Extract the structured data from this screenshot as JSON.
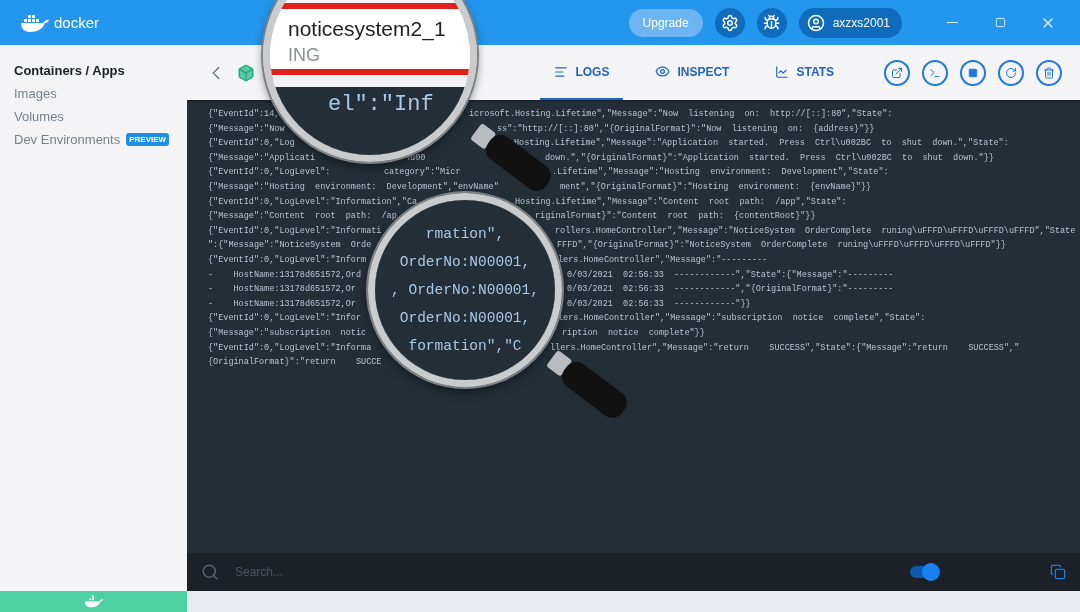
{
  "topbar": {
    "logo_text": "docker",
    "upgrade": "Upgrade",
    "user": "axzxs2001"
  },
  "sidebar": {
    "items": [
      {
        "label": "Containers / Apps",
        "selected": true
      },
      {
        "label": "Images",
        "selected": false
      },
      {
        "label": "Volumes",
        "selected": false
      },
      {
        "label": "Dev Environments",
        "selected": false,
        "badge": "PREVIEW"
      }
    ]
  },
  "tabs": [
    {
      "label": "LOGS",
      "selected": true
    },
    {
      "label": "INSPECT",
      "selected": false
    },
    {
      "label": "STATS",
      "selected": false
    }
  ],
  "log_lines": [
    [
      "{\"EventId\":14,",
      "icrosoft.Hosting.Lifetime\",\"Message\":\"Now  listening  on:  http://[::]:80\",\"State\":"
    ],
    [
      "{\"Message\":\"Now",
      "ss\":\"http://[::]:80\",\"{OriginalFormat}\":\"Now  listening  on:  {address}\"}}"
    ],
    [
      "{\"EventId\":0,\"Log",
      "Hosting.Lifetime\",\"Message\":\"Application  started.  Press  Ctrl\\u002BC  to  shut  down.\",\"State\":"
    ],
    [
      "{\"Message\":\"Applicati",
      "\\u00",
      "down.\",\"{OriginalFormat}\":\"Application  started.  Press  Ctrl\\u002BC  to  shut  down.\"}}"
    ],
    [
      "{\"EventId\":0,\"LogLevel\":",
      "category\":\"Micr",
      ".Lifetime\",\"Message\":\"Hosting  environment:  Development\",\"State\":"
    ],
    [
      "{\"Message\":\"Hosting  environment:  Development\",\"envName\"",
      "ment\",\"{OriginalFormat}\":\"Hosting  environment:  {envName}\"}}"
    ],
    [
      "{\"EventId\":0,\"LogLevel\":\"Information\",\"Ca",
      "Hosting.Lifetime\",\"Message\":\"Content  root  path:  /app\",\"State\":"
    ],
    [
      "{\"Message\":\"Content  root  path:  /ap",
      "riginalFormat}\":\"Content  root  path:  {contentRoot}\"}}"
    ],
    [
      "{\"EventId\":0,\"LogLevel\":\"Informati",
      "rollers.HomeController\",\"Message\":\"NoticeSystem  OrderComplete  runing\\uFFFD\\uFFFD\\uFFFD\\uFFFD\",\"State"
    ],
    [
      "\":{\"Message\":\"NoticeSystem  Orde",
      "FFFD\",\"{OriginalFormat}\":\"NoticeSystem  OrderComplete  runing\\uFFFD\\uFFFD\\uFFFD\\uFFFD\"}}"
    ],
    [
      "{\"EventId\":0,\"LogLevel\":\"Inform",
      "lers.HomeController\",\"Message\":\"---------"
    ],
    [
      "-    HostName:13178d651572,Ord",
      "0/03/2021  02:56:33  ------------\",\"State\":{\"Message\":\"---------"
    ],
    [
      "-    HostName:13178d651572,Or",
      "0/03/2021  02:56:33  ------------\",\"{OriginalFormat}\":\"---------"
    ],
    [
      "-    HostName:13178d651572,Or",
      "0/03/2021  02:56:33  ------------\"}}"
    ],
    [
      "{\"EventId\":0,\"LogLevel\":\"Infor",
      "lers.HomeController\",\"Message\":\"subscription  notice  complete\",\"State\":"
    ],
    [
      "{\"Message\":\"subscription  notic",
      "ription  notice  complete\"}}"
    ],
    [
      "{\"EventId\":0,\"LogLevel\":\"Informa",
      "llers.HomeController\",\"Message\":\"return    SUCCESS\",\"State\":{\"Message\":\"return    SUCCESS\",\""
    ],
    [
      "{OriginalFormat}\":\"return    SUCCE"
    ]
  ],
  "magnifier_top": {
    "title": "noticesystem2_1",
    "status": "ING",
    "log_fragment": "el\":\"Inf"
  },
  "magnifier_bottom": {
    "lines": [
      "rmation\",",
      "OrderNo:N00001,",
      ", OrderNo:N00001,",
      "OrderNo:N00001,",
      "formation\",\"C"
    ]
  },
  "search": {
    "placeholder": "Search..."
  },
  "stick_to_bottom": {
    "on": true
  }
}
